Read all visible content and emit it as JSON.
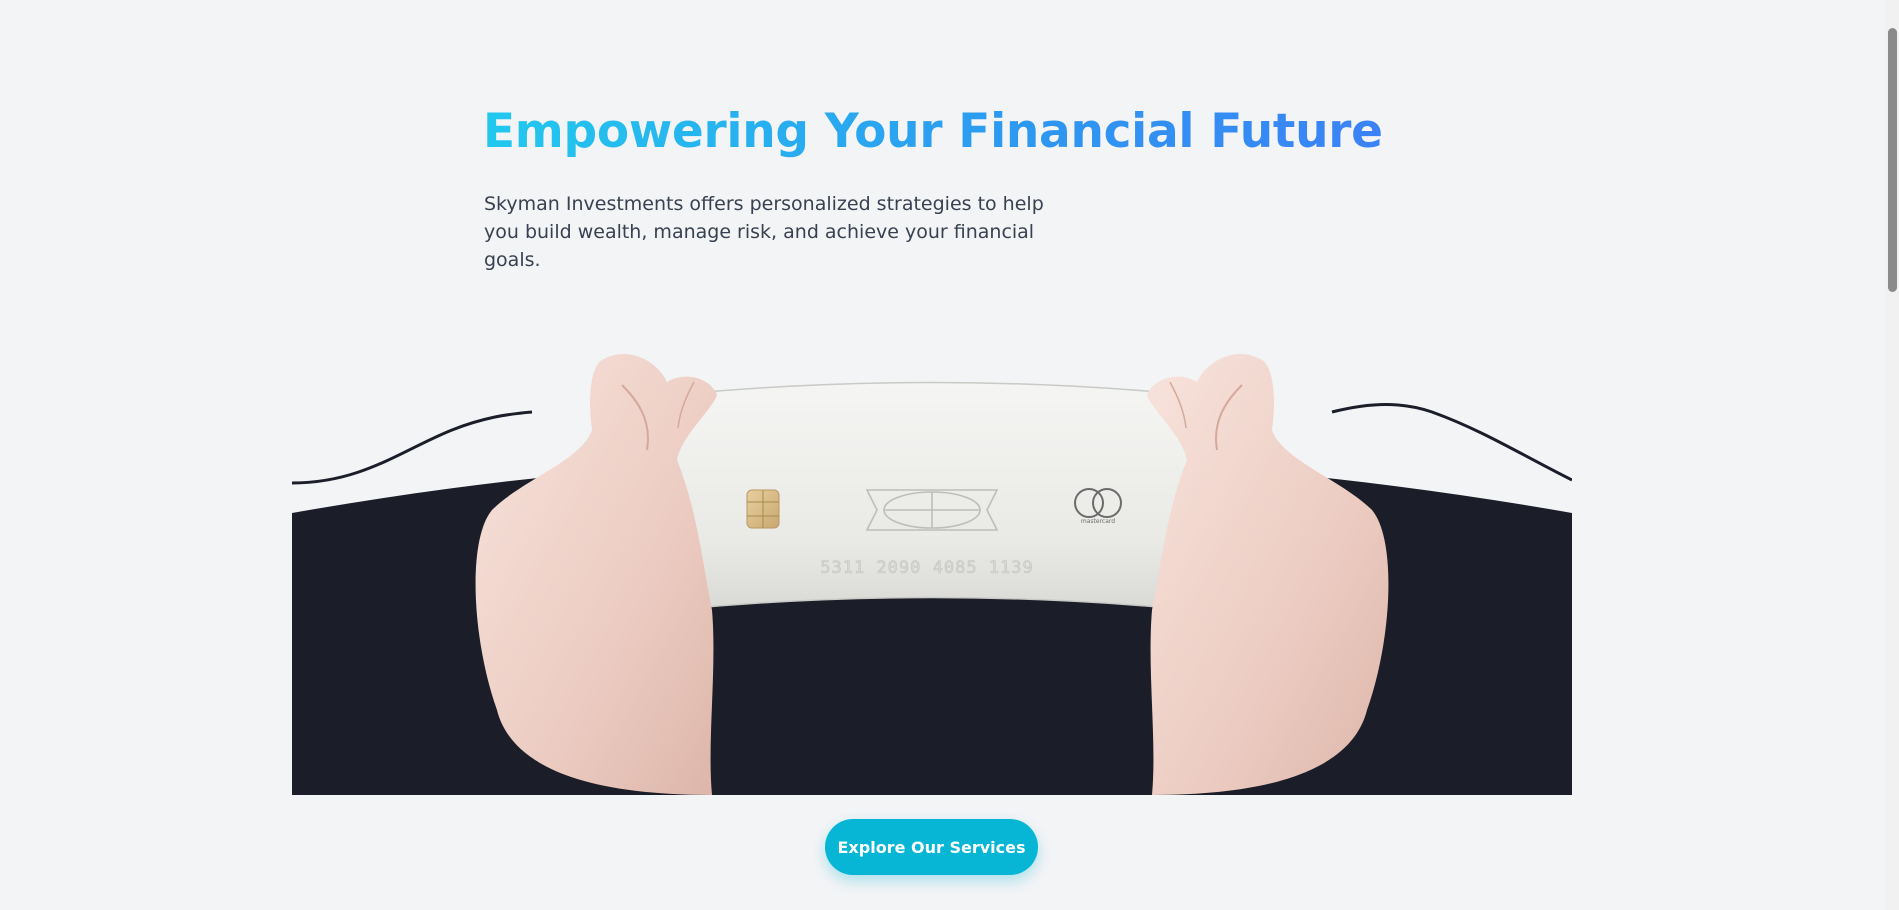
{
  "hero": {
    "title": "Empowering Your Financial Future",
    "subtitle": "Skyman Investments offers personalized strategies to help you build wealth, manage risk, and achieve your financial goals.",
    "image": {
      "card_network": "mastercard",
      "card_number": "5311 2090 4085 1139"
    },
    "cta_label": "Explore Our Services"
  },
  "colors": {
    "accent": "#06b6d4",
    "title_gradient_start": "#22c8ee",
    "title_gradient_end": "#3b82f6",
    "dark_backdrop": "#1b1e29",
    "page_background": "#f3f4f6"
  }
}
